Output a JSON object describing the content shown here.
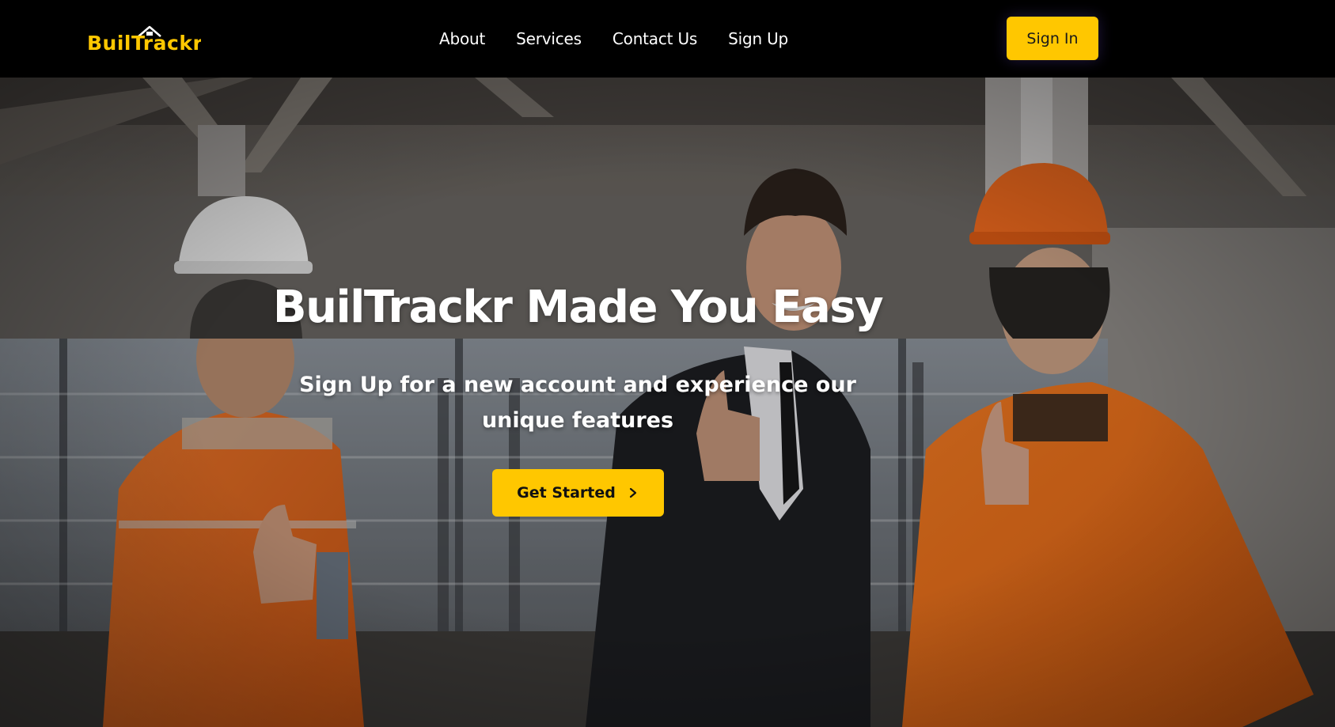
{
  "header": {
    "logo_text": "BuilTrackr",
    "nav": [
      {
        "label": "About"
      },
      {
        "label": "Services"
      },
      {
        "label": "Contact Us"
      },
      {
        "label": "Sign Up"
      }
    ],
    "signin_label": "Sign In"
  },
  "hero": {
    "title": "BuilTrackr Made You Easy",
    "subtitle": "Sign Up for a new account and experience our unique features",
    "cta_label": "Get Started",
    "cta_icon": "chevron-right-icon",
    "background_image": "three construction workers giving thumbs up in front of building"
  },
  "colors": {
    "accent": "#ffc700",
    "navbar_bg": "#000000",
    "text_light": "#ffffff"
  }
}
